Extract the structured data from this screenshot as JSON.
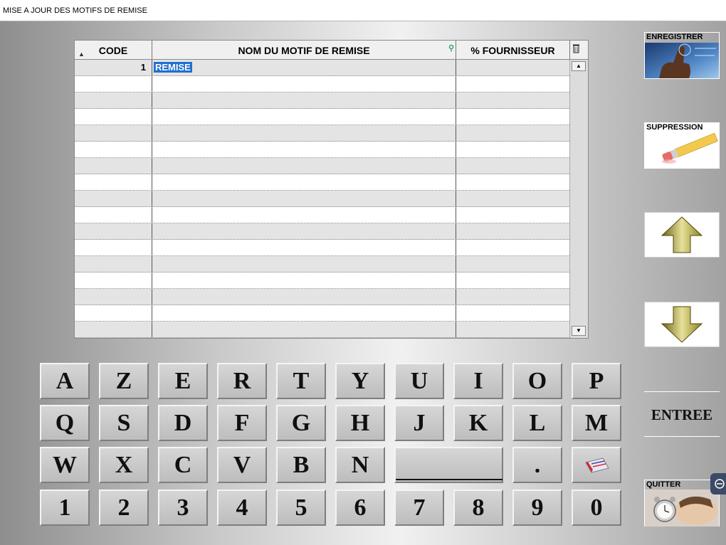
{
  "window": {
    "title": "MISE A JOUR DES MOTIFS DE REMISE"
  },
  "grid": {
    "columns": [
      "CODE",
      "NOM DU MOTIF DE REMISE",
      "% FOURNISSEUR"
    ],
    "rows": [
      {
        "code": "1",
        "nom": "REMISE",
        "pct": ""
      }
    ]
  },
  "keyboard": {
    "row1": [
      "A",
      "Z",
      "E",
      "R",
      "T",
      "Y",
      "U",
      "I",
      "O",
      "P"
    ],
    "row2": [
      "Q",
      "S",
      "D",
      "F",
      "G",
      "H",
      "J",
      "K",
      "L",
      "M"
    ],
    "row3": [
      "W",
      "X",
      "C",
      "V",
      "B",
      "N"
    ],
    "dot": ".",
    "digits": [
      "1",
      "2",
      "3",
      "4",
      "5",
      "6",
      "7",
      "8",
      "9",
      "0"
    ]
  },
  "buttons": {
    "save": "ENREGISTRER",
    "delete": "SUPPRESSION",
    "enter": "ENTREE",
    "quit": "QUITTER"
  },
  "icons": {
    "sort": "sort-up-icon",
    "search": "search-icon",
    "trash": "trash-icon",
    "up": "arrow-up-icon",
    "down": "arrow-down-icon",
    "backspace": "eraser-icon",
    "collapse": "collapse-icon"
  }
}
